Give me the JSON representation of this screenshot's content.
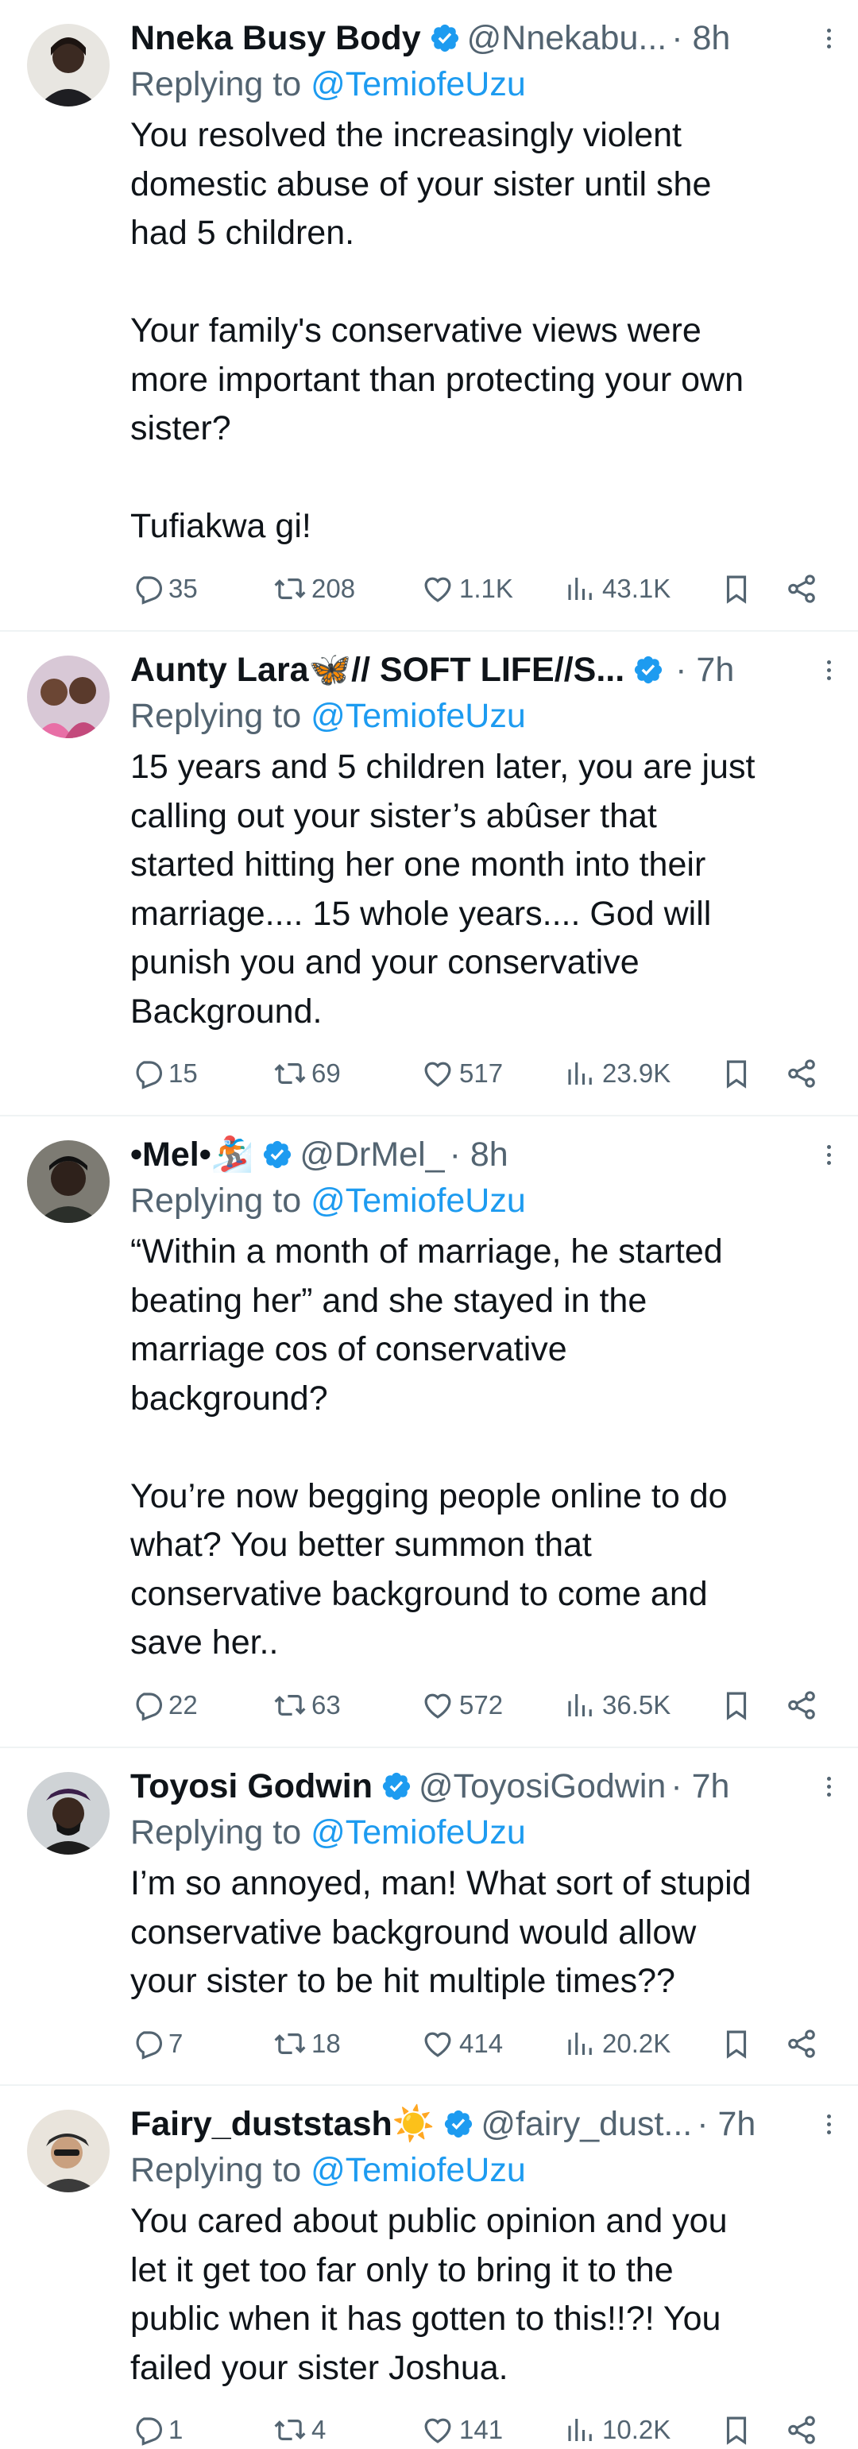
{
  "tweets": [
    {
      "name": "Nneka Busy Body",
      "handle": "@Nnekabu...",
      "time": "· 8h",
      "replying_prefix": "Replying to",
      "replying_to": "@TemiofeUzu",
      "body": [
        "You resolved the increasingly violent",
        "domestic abuse of your sister until she",
        "had 5 children.",
        "",
        "Your family's conservative views were",
        "more important than protecting your own",
        "sister?",
        "",
        "Tufiakwa gi!"
      ],
      "replies": "35",
      "retweets": "208",
      "likes": "1.1K",
      "views": "43.1K"
    },
    {
      "name": "Aunty Lara🦋// SOFT LIFE//S...",
      "handle": "",
      "time": "· 7h",
      "replying_prefix": "Replying to",
      "replying_to": "@TemiofeUzu",
      "body": [
        "15 years and 5 children later, you are just",
        "calling out your sister’s abûser that",
        "started hitting her one month into their",
        "marriage.... 15 whole years.... God will",
        "punish you and your conservative",
        "Background."
      ],
      "replies": "15",
      "retweets": "69",
      "likes": "517",
      "views": "23.9K"
    },
    {
      "name": "•Mel•🏂",
      "handle": "@DrMel_",
      "time": "· 8h",
      "replying_prefix": "Replying to",
      "replying_to": "@TemiofeUzu",
      "body": [
        "“Within a month of marriage, he started",
        "beating her” and she stayed in the",
        "marriage cos of conservative",
        "background?",
        "",
        "You’re now begging people online to do",
        "what? You better summon that",
        "conservative background to come and",
        "save her.."
      ],
      "replies": "22",
      "retweets": "63",
      "likes": "572",
      "views": "36.5K"
    },
    {
      "name": "Toyosi Godwin",
      "handle": "@ToyosiGodwin",
      "time": "· 7h",
      "replying_prefix": "Replying to",
      "replying_to": "@TemiofeUzu",
      "body": [
        "I’m so annoyed, man! What sort of stupid",
        "conservative background would allow",
        "your sister to be hit multiple times??"
      ],
      "replies": "7",
      "retweets": "18",
      "likes": "414",
      "views": "20.2K"
    },
    {
      "name": "Fairy_duststash☀️",
      "handle": "@fairy_dust...",
      "time": "· 7h",
      "replying_prefix": "Replying to",
      "replying_to": "@TemiofeUzu",
      "body": [
        "You cared about public opinion and you",
        "let it get too far only to bring it to the",
        "public when it has gotten to this!!?! You",
        "failed your sister Joshua."
      ],
      "replies": "1",
      "retweets": "4",
      "likes": "141",
      "views": "10.2K"
    }
  ],
  "icons": {
    "reply": "reply-icon",
    "retweet": "retweet-icon",
    "like": "heart-icon",
    "views": "views-icon",
    "bookmark": "bookmark-icon",
    "share": "share-icon",
    "verified": "verified-badge-icon",
    "more": "more-options-icon"
  },
  "colors": {
    "text": "#0f1419",
    "secondary": "#536471",
    "accent": "#1d9bf0",
    "divider": "#eff3f4"
  }
}
